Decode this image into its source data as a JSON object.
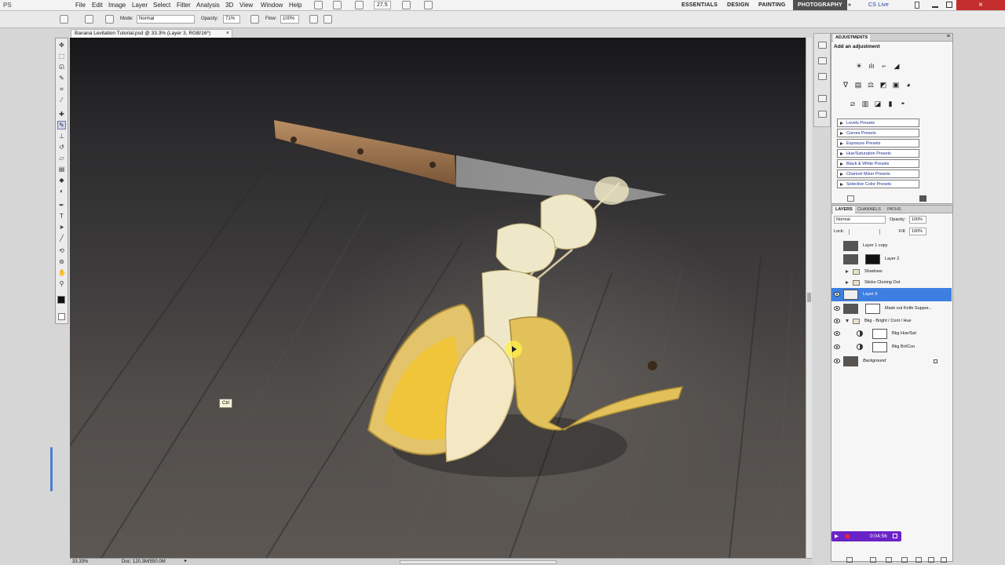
{
  "app": {
    "logo": "PS"
  },
  "menu": [
    "File",
    "Edit",
    "Image",
    "Layer",
    "Select",
    "Filter",
    "Analysis",
    "3D",
    "View",
    "Window",
    "Help"
  ],
  "topbar": {
    "zoom": "27.5",
    "workspaces": [
      "ESSENTIALS",
      "DESIGN",
      "PAINTING",
      "PHOTOGRAPHY"
    ],
    "active_workspace": "PHOTOGRAPHY",
    "cs_live": "CS Live"
  },
  "options": {
    "mode_label": "Mode:",
    "mode_value": "Normal",
    "opacity_label": "Opacity:",
    "opacity_value": "71%",
    "flow_label": "Flow:",
    "flow_value": "100%"
  },
  "document": {
    "tab_title": "Banana Levitation Tutorial.psd @ 33.3% (Layer 3, RGB/16*)",
    "tooltip": "Ctrl"
  },
  "status": {
    "zoom": "33.33%",
    "doc": "Doc: 120.3M/550.0M"
  },
  "adjustments": {
    "tab": "ADJUSTMENTS",
    "heading": "Add an adjustment",
    "presets": [
      "Levels Presets",
      "Curves Presets",
      "Exposure Presets",
      "Hue/Saturation Presets",
      "Black & White Presets",
      "Channel Mixer Presets",
      "Selective Color Presets"
    ]
  },
  "layers_panel": {
    "tabs": [
      "LAYERS",
      "CHANNELS",
      "PATHS"
    ],
    "blend_mode": "Normal",
    "opacity_label": "Opacity:",
    "opacity_value": "100%",
    "lock_label": "Lock:",
    "fill_label": "Fill:",
    "fill_value": "100%",
    "layers": [
      {
        "name": "Layer 1 copy"
      },
      {
        "name": "Layer 2"
      },
      {
        "name": "Shadows"
      },
      {
        "name": "Sticks Cloning Out"
      },
      {
        "name": "Layer 3"
      },
      {
        "name": "Mask out Knife Suppor..."
      },
      {
        "name": "Bkg - Bright / Cont / Hue"
      },
      {
        "name": "Bkg Hue/Sat"
      },
      {
        "name": "Bkg Bri/Con"
      },
      {
        "name": "Background"
      }
    ],
    "selected_layer": "Layer 3"
  },
  "timer": {
    "time": "0:04:56"
  },
  "colors": {
    "selection": "#3d7fe0",
    "timer": "#6a23c6",
    "banana_yellow": "#f1c53a"
  }
}
